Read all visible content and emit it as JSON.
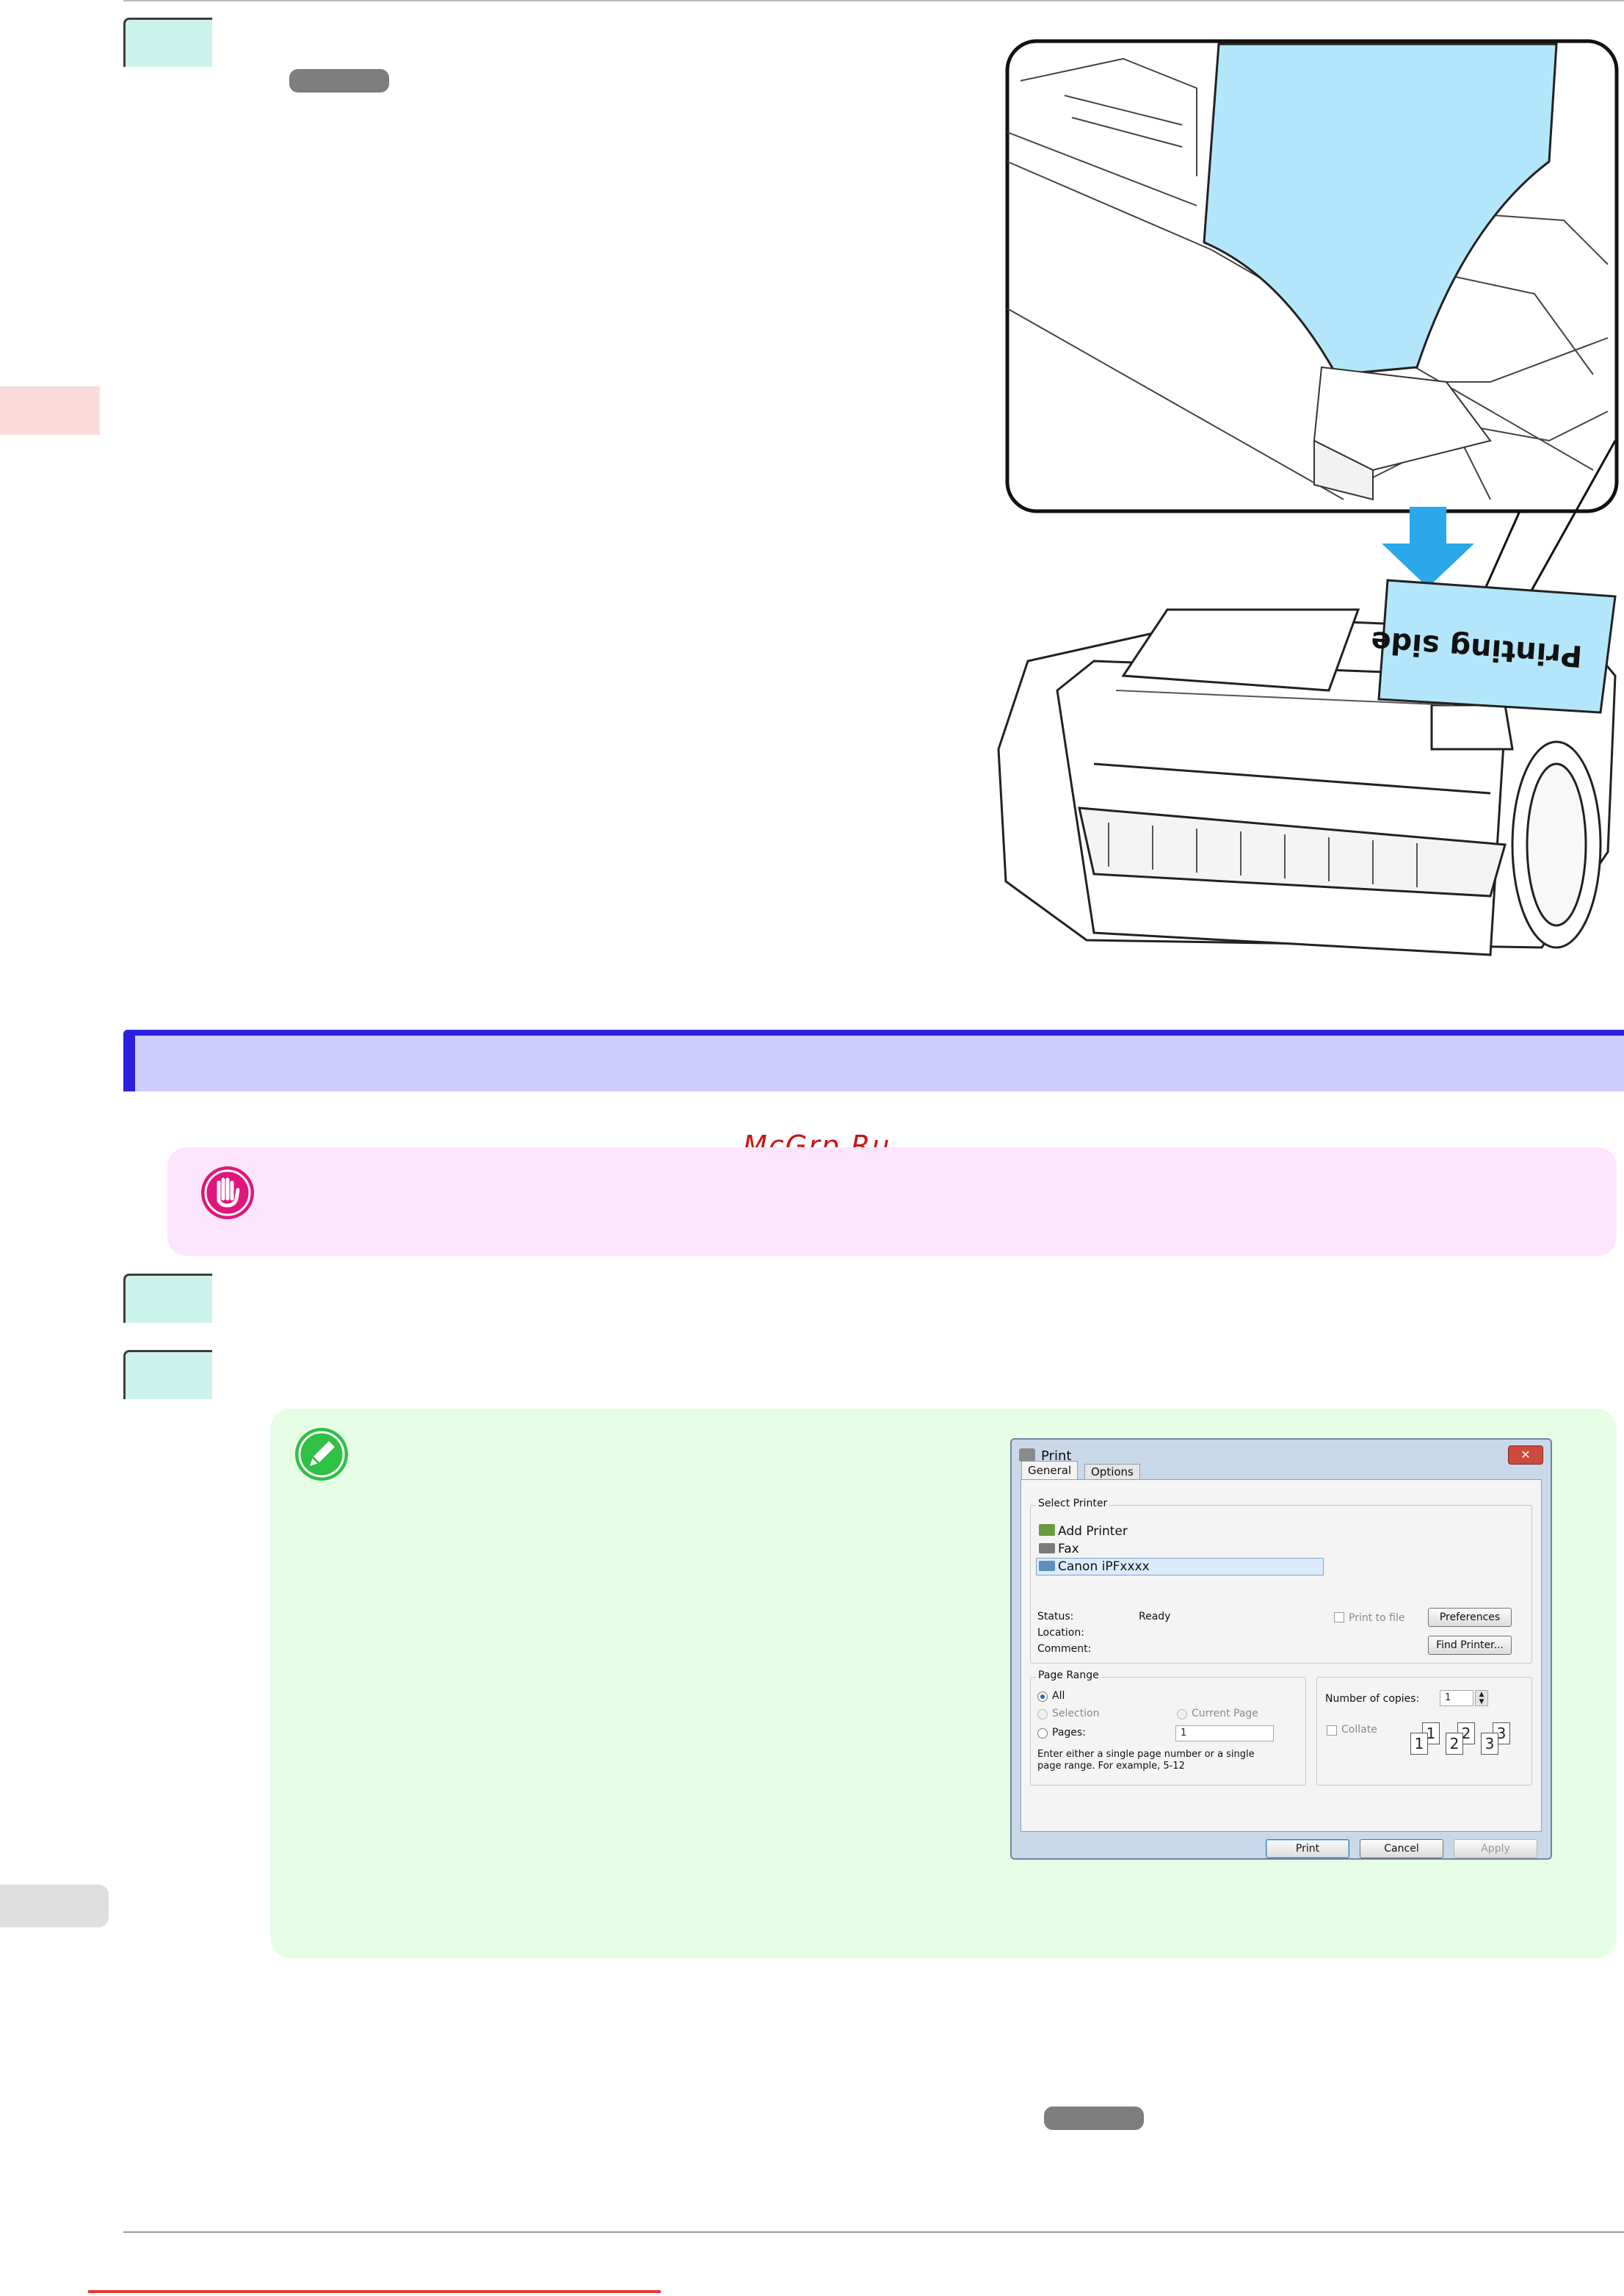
{
  "watermark": "McGrp.Ru",
  "illustration": {
    "paper_label": "Printing side",
    "paper_color": "#b3e6fa",
    "arrow_color": "#2aa8ea"
  },
  "important_icon": "hand-stop-icon",
  "note_icon": "pencil-icon",
  "print_dialog": {
    "title": "Print",
    "close_label": "✕",
    "tabs": [
      "General",
      "Options"
    ],
    "select_printer_label": "Select Printer",
    "printers": [
      "Add Printer",
      "Fax",
      "Canon iPFxxxx"
    ],
    "status_label": "Status:",
    "status_value": "Ready",
    "location_label": "Location:",
    "comment_label": "Comment:",
    "print_to_file_label": "Print to file",
    "preferences_label": "Preferences",
    "find_printer_label": "Find Printer...",
    "page_range_label": "Page Range",
    "all_label": "All",
    "selection_label": "Selection",
    "current_page_label": "Current Page",
    "pages_label": "Pages:",
    "pages_value": "1",
    "range_hint_line1": "Enter either a single page number or a single",
    "range_hint_line2": "page range.  For example, 5-12",
    "copies_label": "Number of copies:",
    "copies_value": "1",
    "collate_label": "Collate",
    "collate_pages": [
      "1",
      "1",
      "2",
      "2",
      "3",
      "3"
    ],
    "print_button": "Print",
    "cancel_button": "Cancel",
    "apply_button": "Apply"
  }
}
